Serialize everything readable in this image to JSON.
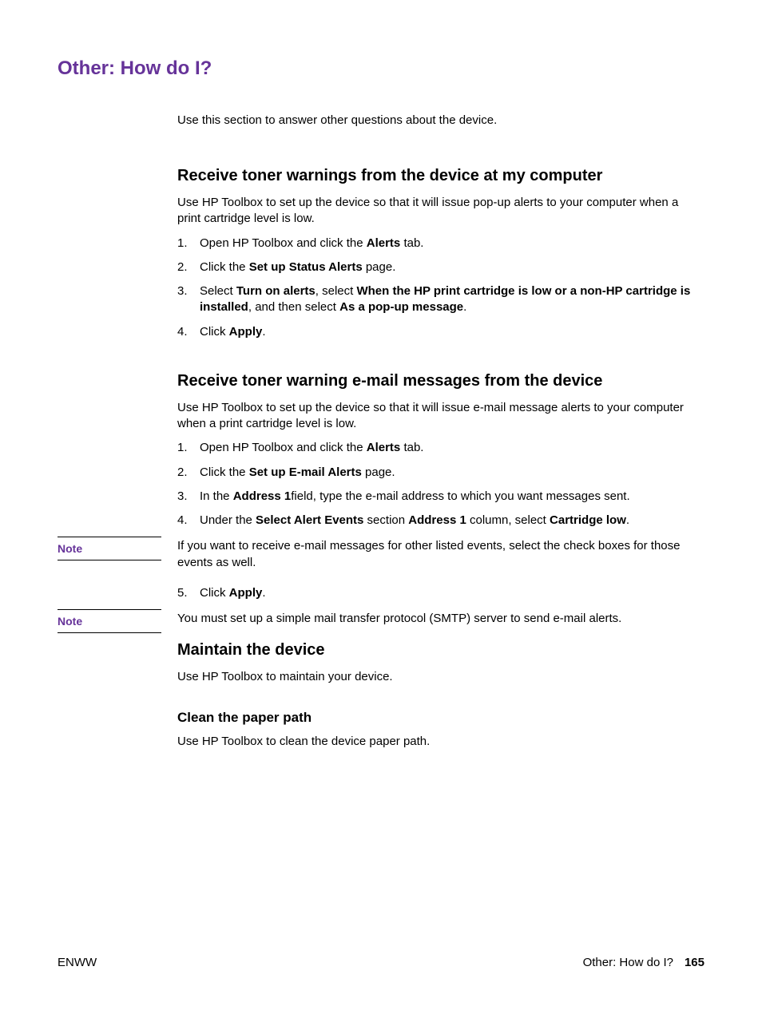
{
  "title": "Other: How do I?",
  "intro": "Use this section to answer other questions about the device.",
  "section1": {
    "heading": "Receive toner warnings from the device at my computer",
    "para": "Use HP Toolbox to set up the device so that it will issue pop-up alerts to your computer when a print cartridge level is low.",
    "steps": {
      "s1a": "Open HP Toolbox and click the ",
      "s1b": "Alerts",
      "s1c": " tab.",
      "s2a": "Click the ",
      "s2b": "Set up Status Alerts",
      "s2c": " page.",
      "s3a": "Select ",
      "s3b": "Turn on alerts",
      "s3c": ", select ",
      "s3d": "When the HP print cartridge is low or a non-HP cartridge is installed",
      "s3e": ", and then select ",
      "s3f": "As a pop-up message",
      "s3g": ".",
      "s4a": "Click ",
      "s4b": "Apply",
      "s4c": "."
    }
  },
  "section2": {
    "heading": "Receive toner warning e-mail messages from the device",
    "para": "Use HP Toolbox to set up the device so that it will issue e-mail message alerts to your computer when a print cartridge level is low.",
    "steps": {
      "s1a": "Open HP Toolbox and click the ",
      "s1b": "Alerts",
      "s1c": " tab.",
      "s2a": "Click the ",
      "s2b": "Set up E-mail Alerts",
      "s2c": " page.",
      "s3a": "In the ",
      "s3b": "Address 1",
      "s3c": "field, type the e-mail address to which you want messages sent.",
      "s4a": "Under the ",
      "s4b": "Select Alert Events",
      "s4c": " section ",
      "s4d": "Address 1",
      "s4e": " column, select ",
      "s4f": "Cartridge low",
      "s4g": "."
    },
    "note1Label": "Note",
    "note1Text": "If you want to receive e-mail messages for other listed events, select the check boxes for those events as well.",
    "step5num": "5.",
    "step5a": "Click ",
    "step5b": "Apply",
    "step5c": ".",
    "note2Label": "Note",
    "note2Text": "You must set up a simple mail transfer protocol (SMTP) server to send e-mail alerts."
  },
  "section3": {
    "heading": "Maintain the device",
    "para": "Use HP Toolbox to maintain your device.",
    "sub": {
      "heading": "Clean the paper path",
      "para": "Use HP Toolbox to clean the device paper path."
    }
  },
  "footer": {
    "left": "ENWW",
    "rightLabel": "Other: How do I?",
    "pageNum": "165"
  }
}
